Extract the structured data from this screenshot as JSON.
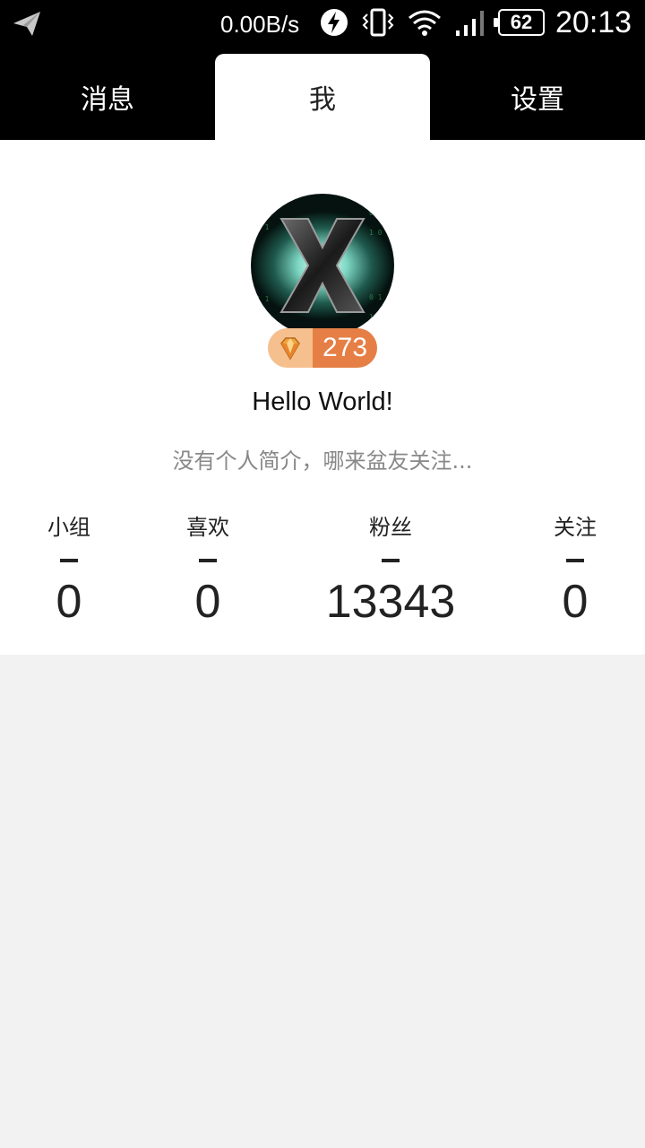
{
  "status_bar": {
    "network_speed": "0.00B/s",
    "battery_level": "62",
    "time": "20:13",
    "icons": [
      "send-icon",
      "flash-icon",
      "vibrate-icon",
      "wifi-icon",
      "signal-icon",
      "battery-icon"
    ]
  },
  "tabs": [
    {
      "label": "消息",
      "active": false
    },
    {
      "label": "我",
      "active": true
    },
    {
      "label": "设置",
      "active": false
    }
  ],
  "profile": {
    "avatar_icon": "matrix-x-avatar",
    "badge": {
      "icon": "gem-icon",
      "count": "273"
    },
    "username": "Hello World!",
    "bio": "没有个人简介，哪来盆友关注...",
    "stats": [
      {
        "label": "小组",
        "value": "0"
      },
      {
        "label": "喜欢",
        "value": "0"
      },
      {
        "label": "粉丝",
        "value": "13343"
      },
      {
        "label": "关注",
        "value": "0"
      }
    ]
  },
  "colors": {
    "status_bar_bg": "#000000",
    "tab_bar_bg": "#000000",
    "active_tab_bg": "#ffffff",
    "page_bg": "#f2f2f2",
    "badge_light": "#f6bf8e",
    "badge_dark": "#e67f45",
    "bio_text": "#888888"
  }
}
